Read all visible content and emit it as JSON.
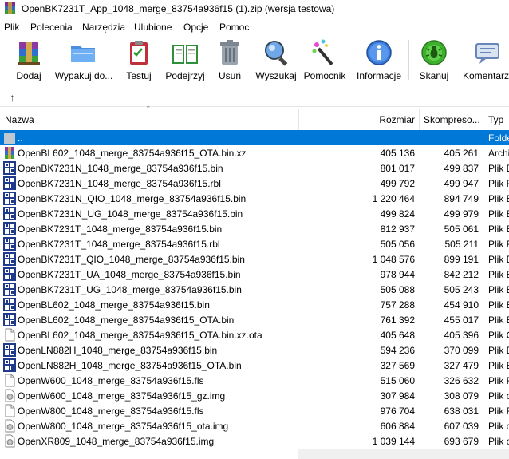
{
  "window": {
    "title": "OpenBK7231T_App_1048_merge_83754a936f15 (1).zip (wersja testowa)"
  },
  "menu": [
    "Plik",
    "Polecenia",
    "Narzędzia",
    "Ulubione",
    "Opcje",
    "Pomoc"
  ],
  "toolbar": [
    {
      "label": "Dodaj",
      "icon": "add-archive-icon"
    },
    {
      "label": "Wypakuj do...",
      "icon": "extract-folder-icon"
    },
    {
      "label": "Testuj",
      "icon": "test-clipboard-icon"
    },
    {
      "label": "Podejrzyj",
      "icon": "view-book-icon"
    },
    {
      "label": "Usuń",
      "icon": "trash-bin-icon"
    },
    {
      "label": "Wyszukaj",
      "icon": "find-magnifier-icon"
    },
    {
      "label": "Pomocnik",
      "icon": "wizard-wand-icon"
    },
    {
      "label": "Informacje",
      "icon": "info-icon"
    },
    {
      "label": "Skanuj",
      "icon": "virus-scan-icon"
    },
    {
      "label": "Komentarz...",
      "icon": "comment-icon"
    }
  ],
  "columns": {
    "name": "Nazwa",
    "size": "Rozmiar",
    "packed": "Skompreso...",
    "type": "Typ"
  },
  "colors": {
    "selection": "#0078d7",
    "header_border": "#e5e5e5"
  },
  "files": [
    {
      "name": "..",
      "size": "",
      "packed": "",
      "type": "Folder",
      "icon": "folder-up-icon",
      "selected": true
    },
    {
      "name": "OpenBL602_1048_merge_83754a936f15_OTA.bin.xz",
      "size": "405 136",
      "packed": "405 261",
      "type": "Archi",
      "icon": "archive-icon"
    },
    {
      "name": "OpenBK7231N_1048_merge_83754a936f15.bin",
      "size": "801 017",
      "packed": "499 837",
      "type": "Plik B",
      "icon": "binary-file-icon"
    },
    {
      "name": "OpenBK7231N_1048_merge_83754a936f15.rbl",
      "size": "499 792",
      "packed": "499 947",
      "type": "Plik R",
      "icon": "binary-file-icon"
    },
    {
      "name": "OpenBK7231N_QIO_1048_merge_83754a936f15.bin",
      "size": "1 220 464",
      "packed": "894 749",
      "type": "Plik B",
      "icon": "binary-file-icon"
    },
    {
      "name": "OpenBK7231N_UG_1048_merge_83754a936f15.bin",
      "size": "499 824",
      "packed": "499 979",
      "type": "Plik B",
      "icon": "binary-file-icon"
    },
    {
      "name": "OpenBK7231T_1048_merge_83754a936f15.bin",
      "size": "812 937",
      "packed": "505 061",
      "type": "Plik B",
      "icon": "binary-file-icon"
    },
    {
      "name": "OpenBK7231T_1048_merge_83754a936f15.rbl",
      "size": "505 056",
      "packed": "505 211",
      "type": "Plik R",
      "icon": "binary-file-icon"
    },
    {
      "name": "OpenBK7231T_QIO_1048_merge_83754a936f15.bin",
      "size": "1 048 576",
      "packed": "899 191",
      "type": "Plik B",
      "icon": "binary-file-icon"
    },
    {
      "name": "OpenBK7231T_UA_1048_merge_83754a936f15.bin",
      "size": "978 944",
      "packed": "842 212",
      "type": "Plik B",
      "icon": "binary-file-icon"
    },
    {
      "name": "OpenBK7231T_UG_1048_merge_83754a936f15.bin",
      "size": "505 088",
      "packed": "505 243",
      "type": "Plik B",
      "icon": "binary-file-icon"
    },
    {
      "name": "OpenBL602_1048_merge_83754a936f15.bin",
      "size": "757 288",
      "packed": "454 910",
      "type": "Plik B",
      "icon": "binary-file-icon"
    },
    {
      "name": "OpenBL602_1048_merge_83754a936f15_OTA.bin",
      "size": "761 392",
      "packed": "455 017",
      "type": "Plik B",
      "icon": "binary-file-icon"
    },
    {
      "name": "OpenBL602_1048_merge_83754a936f15_OTA.bin.xz.ota",
      "size": "405 648",
      "packed": "405 396",
      "type": "Plik O",
      "icon": "blank-file-icon"
    },
    {
      "name": "OpenLN882H_1048_merge_83754a936f15.bin",
      "size": "594 236",
      "packed": "370 099",
      "type": "Plik B",
      "icon": "binary-file-icon"
    },
    {
      "name": "OpenLN882H_1048_merge_83754a936f15_OTA.bin",
      "size": "327 569",
      "packed": "327 479",
      "type": "Plik B",
      "icon": "binary-file-icon"
    },
    {
      "name": "OpenW600_1048_merge_83754a936f15.fls",
      "size": "515 060",
      "packed": "326 632",
      "type": "Plik F",
      "icon": "blank-file-icon"
    },
    {
      "name": "OpenW600_1048_merge_83754a936f15_gz.img",
      "size": "307 984",
      "packed": "308 079",
      "type": "Plik o",
      "icon": "disk-image-icon"
    },
    {
      "name": "OpenW800_1048_merge_83754a936f15.fls",
      "size": "976 704",
      "packed": "638 031",
      "type": "Plik F",
      "icon": "blank-file-icon"
    },
    {
      "name": "OpenW800_1048_merge_83754a936f15_ota.img",
      "size": "606 884",
      "packed": "607 039",
      "type": "Plik o",
      "icon": "disk-image-icon"
    },
    {
      "name": "OpenXR809_1048_merge_83754a936f15.img",
      "size": "1 039 144",
      "packed": "693 679",
      "type": "Plik o",
      "icon": "disk-image-icon"
    }
  ]
}
